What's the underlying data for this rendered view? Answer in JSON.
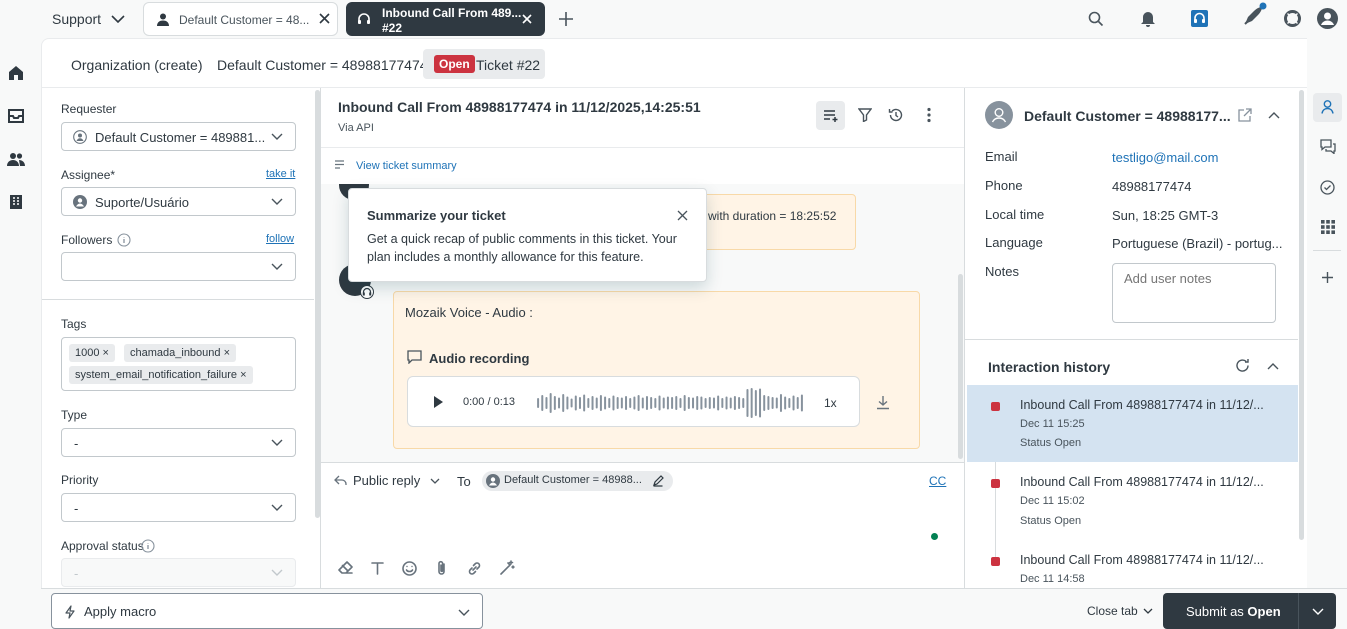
{
  "topbar": {
    "product": "Support",
    "tabs": [
      {
        "label": "Default Customer = 48..."
      },
      {
        "label_line1": "Inbound Call From 489...",
        "label_line2": "#22"
      }
    ]
  },
  "subbar": {
    "breadcrumb_org": "Organization (create)",
    "breadcrumb_user": "Default Customer = 48988177474",
    "status_badge": "Open",
    "ticket": "Ticket #22"
  },
  "left": {
    "requester_label": "Requester",
    "requester_value": "Default Customer = 489881...",
    "assignee_label": "Assignee*",
    "take_it": "take it",
    "assignee_value": "Suporte/Usuário",
    "followers_label": "Followers",
    "follow": "follow",
    "tags_label": "Tags",
    "tags": [
      "1000",
      "chamada_inbound",
      "system_email_notification_failure"
    ],
    "type_label": "Type",
    "type_value": "-",
    "priority_label": "Priority",
    "priority_value": "-",
    "approval_label": "Approval status",
    "approval_value": "-"
  },
  "center": {
    "title": "Inbound Call From 48988177474 in 11/12/2025,14:25:51",
    "via": "Via API",
    "summary_link": "View ticket summary",
    "popover_title": "Summarize your ticket",
    "popover_body": "Get a quick recap of public comments in this ticket. Your plan includes a monthly allowance for this feature.",
    "msg1_tail": "with duration = 18:25:52",
    "msg2_title": "Mozaik Voice - Audio :",
    "audio_label": "Audio recording",
    "audio_time": "0:00 / 0:13",
    "audio_speed": "1x",
    "reply_mode": "Public reply",
    "to_label": "To",
    "to_recipient": "Default Customer = 48988...",
    "cc": "CC"
  },
  "right": {
    "user_name": "Default Customer = 48988177...",
    "email_label": "Email",
    "email_value": "testligo@mail.com",
    "phone_label": "Phone",
    "phone_value": "48988177474",
    "localtime_label": "Local time",
    "localtime_value": "Sun, 18:25 GMT-3",
    "language_label": "Language",
    "language_value": "Portuguese (Brazil) - portug...",
    "notes_label": "Notes",
    "notes_placeholder": "Add user notes",
    "history_title": "Interaction history",
    "history": [
      {
        "title": "Inbound Call From 48988177474 in 11/12/...",
        "time": "Dec 11 15:25",
        "status": "Status Open"
      },
      {
        "title": "Inbound Call From 48988177474 in 11/12/...",
        "time": "Dec 11 15:02",
        "status": "Status Open"
      },
      {
        "title": "Inbound Call From 48988177474 in 11/12/...",
        "time": "Dec 11 14:58",
        "status": ""
      }
    ]
  },
  "bottom": {
    "macro": "Apply macro",
    "close_tab": "Close tab",
    "submit_prefix": "Submit as ",
    "submit_status": "Open"
  },
  "colors": {
    "accent": "#1f73b7",
    "danger": "#cc3340",
    "dark": "#2f3941",
    "selected": "#d4e3f1"
  }
}
